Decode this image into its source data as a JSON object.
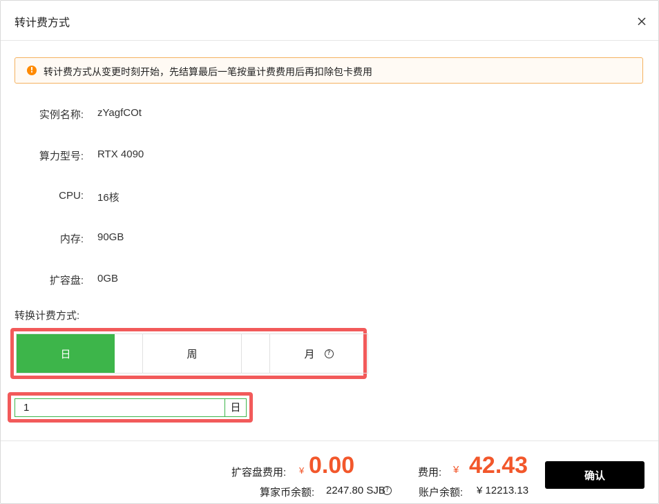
{
  "dialog": {
    "title": "转计费方式",
    "notice": "转计费方式从变更时刻开始，先结算最后一笔按量计费费用后再扣除包卡费用",
    "notice_icon": "warning-circle-icon",
    "fields": [
      {
        "label": "实例名称:",
        "value": "zYagfCOt"
      },
      {
        "label": "算力型号:",
        "value": "RTX 4090"
      },
      {
        "label": "CPU:",
        "value": "16核"
      },
      {
        "label": "内存:",
        "value": "90GB"
      },
      {
        "label": "扩容盘:",
        "value": "0GB"
      }
    ],
    "billing_label": "转换计费方式:",
    "billing_options": [
      {
        "label": "日",
        "selected": true
      },
      {
        "label": "周",
        "selected": false
      },
      {
        "label": "月",
        "selected": false
      }
    ],
    "duration": {
      "value": "1",
      "unit": "日"
    }
  },
  "footer": {
    "expansion_label": "扩容盘费用:",
    "expansion_currency": "¥",
    "expansion_amount": "0.00",
    "fee_label": "费用:",
    "fee_currency": "¥",
    "fee_amount": "42.43",
    "coin_balance_label": "算家币余额:",
    "coin_balance_value": "2247.80 SJB",
    "account_balance_label": "账户余额:",
    "account_balance_value": "¥ 12213.13",
    "confirm_label": "确认"
  },
  "colors": {
    "accent_green": "#3db54a",
    "price_orange": "#f2572b",
    "highlight_red": "#f25a5a",
    "warning": "#ff8a00"
  }
}
